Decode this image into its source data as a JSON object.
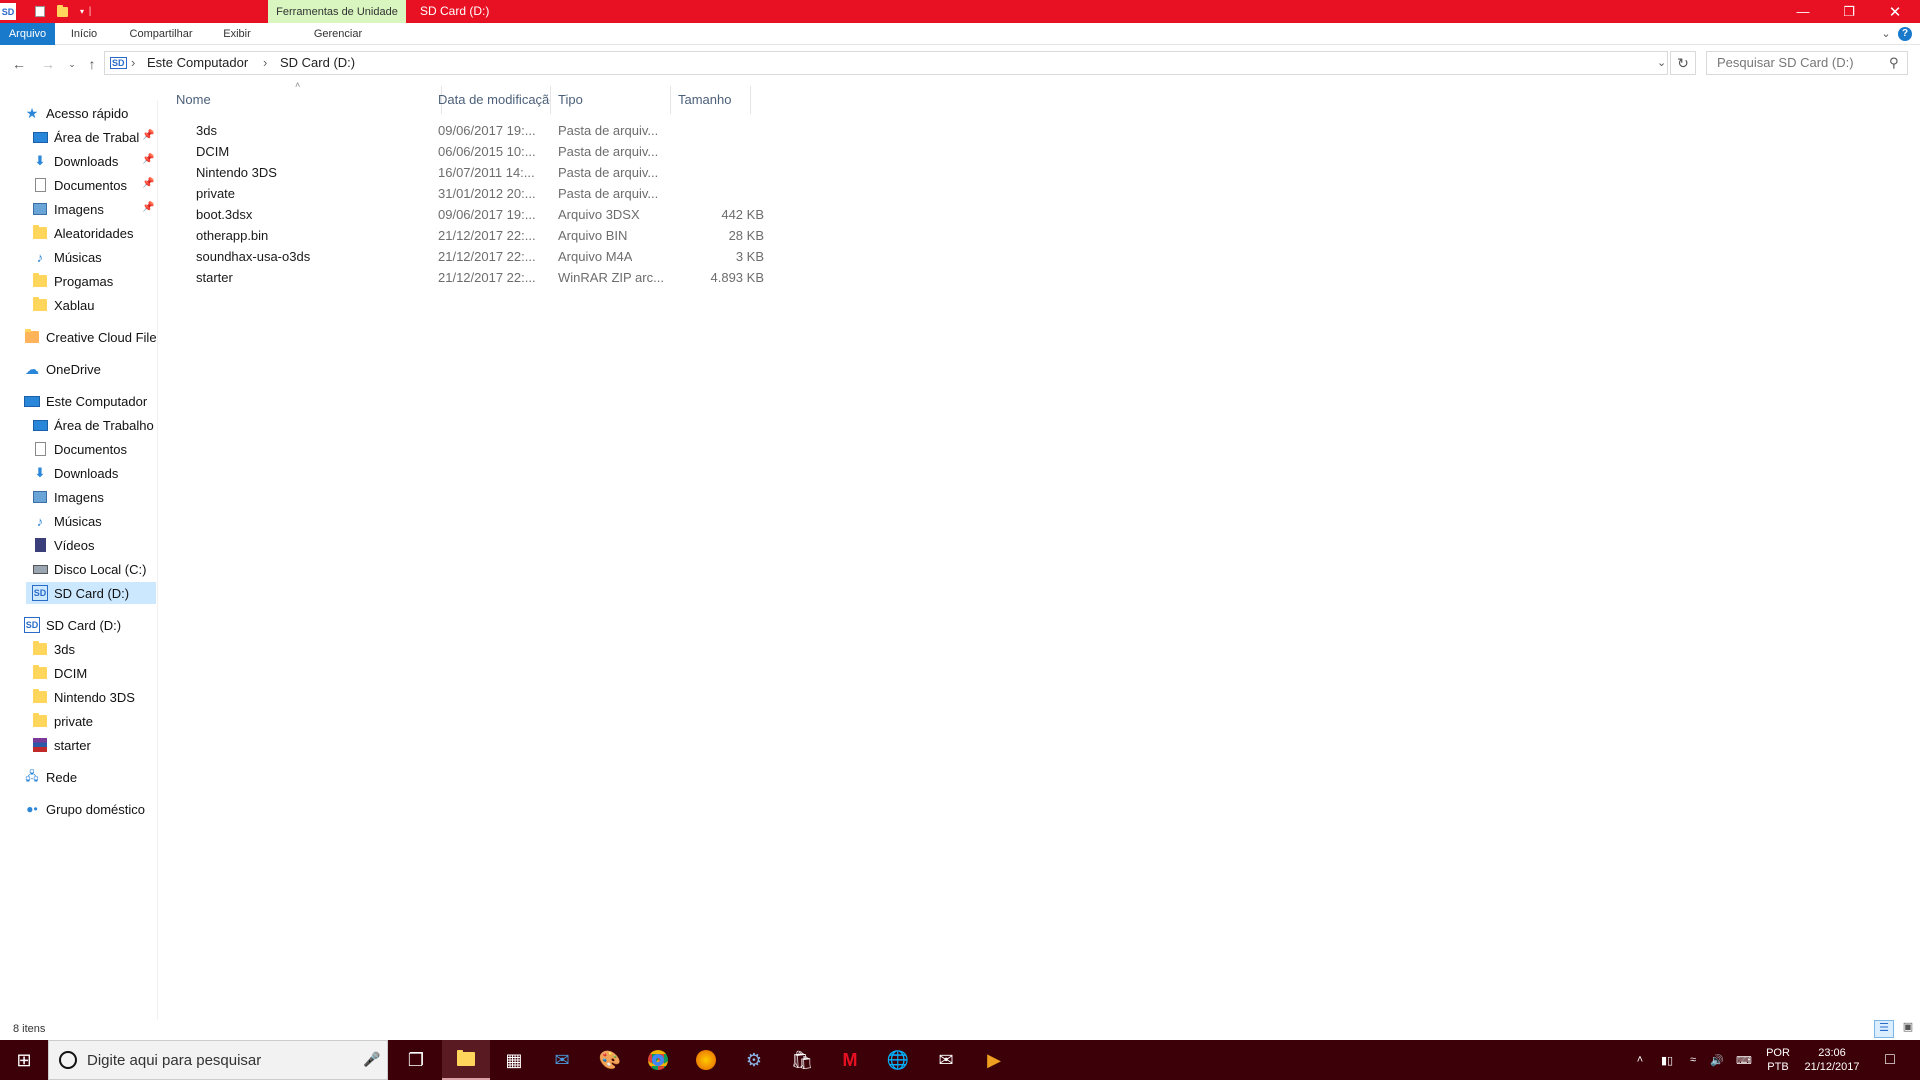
{
  "window": {
    "title": "SD Card (D:)",
    "tools_tab": "Ferramentas de Unidade",
    "qa_icon": "sd-card-icon"
  },
  "ribbon": {
    "tabs": [
      "Arquivo",
      "Início",
      "Compartilhar",
      "Exibir",
      "Gerenciar"
    ],
    "active_tab": "Arquivo"
  },
  "address": {
    "crumbs": [
      "Este Computador",
      "SD Card (D:)"
    ],
    "search_placeholder": "Pesquisar SD Card (D:)"
  },
  "sidebar": {
    "quick_access": "Acesso rápido",
    "quick_items": [
      {
        "label": "Área de Trabal",
        "icon": "desktop-icon",
        "pinned": true
      },
      {
        "label": "Downloads",
        "icon": "download-icon",
        "pinned": true
      },
      {
        "label": "Documentos",
        "icon": "documents-icon",
        "pinned": true
      },
      {
        "label": "Imagens",
        "icon": "pictures-icon",
        "pinned": true
      },
      {
        "label": "Aleatoridades",
        "icon": "folder-icon",
        "pinned": false
      },
      {
        "label": "Músicas",
        "icon": "music-icon",
        "pinned": false
      },
      {
        "label": "Progamas",
        "icon": "folder-icon",
        "pinned": false
      },
      {
        "label": "Xablau",
        "icon": "folder-icon",
        "pinned": false
      }
    ],
    "creative_cloud": "Creative Cloud Files",
    "onedrive": "OneDrive",
    "this_pc": "Este Computador",
    "pc_items": [
      {
        "label": "Área de Trabalho",
        "icon": "desktop-icon"
      },
      {
        "label": "Documentos",
        "icon": "documents-icon"
      },
      {
        "label": "Downloads",
        "icon": "download-icon"
      },
      {
        "label": "Imagens",
        "icon": "pictures-icon"
      },
      {
        "label": "Músicas",
        "icon": "music-icon"
      },
      {
        "label": "Vídeos",
        "icon": "video-icon"
      },
      {
        "label": "Disco Local (C:)",
        "icon": "drive-icon"
      },
      {
        "label": "SD Card (D:)",
        "icon": "sd-card-icon",
        "selected": true
      }
    ],
    "sd_card": "SD Card (D:)",
    "sd_items": [
      {
        "label": "3ds",
        "icon": "folder-icon"
      },
      {
        "label": "DCIM",
        "icon": "folder-icon"
      },
      {
        "label": "Nintendo 3DS",
        "icon": "folder-icon"
      },
      {
        "label": "private",
        "icon": "folder-icon"
      },
      {
        "label": "starter",
        "icon": "winrar-icon"
      }
    ],
    "network": "Rede",
    "homegroup": "Grupo doméstico"
  },
  "columns": [
    "Nome",
    "Data de modificação",
    "Tipo",
    "Tamanho"
  ],
  "files": [
    {
      "name": "3ds",
      "date": "09/06/2017 19:...",
      "type": "Pasta de arquiv...",
      "size": "",
      "icon": "folder-icon"
    },
    {
      "name": "DCIM",
      "date": "06/06/2015 10:...",
      "type": "Pasta de arquiv...",
      "size": "",
      "icon": "folder-icon"
    },
    {
      "name": "Nintendo 3DS",
      "date": "16/07/2011 14:...",
      "type": "Pasta de arquiv...",
      "size": "",
      "icon": "folder-icon"
    },
    {
      "name": "private",
      "date": "31/01/2012 20:...",
      "type": "Pasta de arquiv...",
      "size": "",
      "icon": "folder-icon"
    },
    {
      "name": "boot.3dsx",
      "date": "09/06/2017 19:...",
      "type": "Arquivo 3DSX",
      "size": "442 KB",
      "icon": "file-icon"
    },
    {
      "name": "otherapp.bin",
      "date": "21/12/2017 22:...",
      "type": "Arquivo BIN",
      "size": "28 KB",
      "icon": "file-icon"
    },
    {
      "name": "soundhax-usa-o3ds",
      "date": "21/12/2017 22:...",
      "type": "Arquivo M4A",
      "size": "3 KB",
      "icon": "audio-file-icon"
    },
    {
      "name": "starter",
      "date": "21/12/2017 22:...",
      "type": "WinRAR ZIP arc...",
      "size": "4.893 KB",
      "icon": "winrar-icon"
    }
  ],
  "status": {
    "count": "8 itens"
  },
  "taskbar": {
    "search_placeholder": "Digite aqui para pesquisar",
    "apps": [
      "task-view-icon",
      "file-explorer-icon",
      "calculator-icon",
      "outlook-icon",
      "paint-icon",
      "chrome-icon",
      "firefox-icon",
      "steam-icon",
      "store-icon",
      "mcafee-icon",
      "globe-icon",
      "mail-icon",
      "media-player-icon"
    ],
    "lang": "POR",
    "layout": "PTB",
    "time": "23:06",
    "date": "21/12/2017"
  }
}
